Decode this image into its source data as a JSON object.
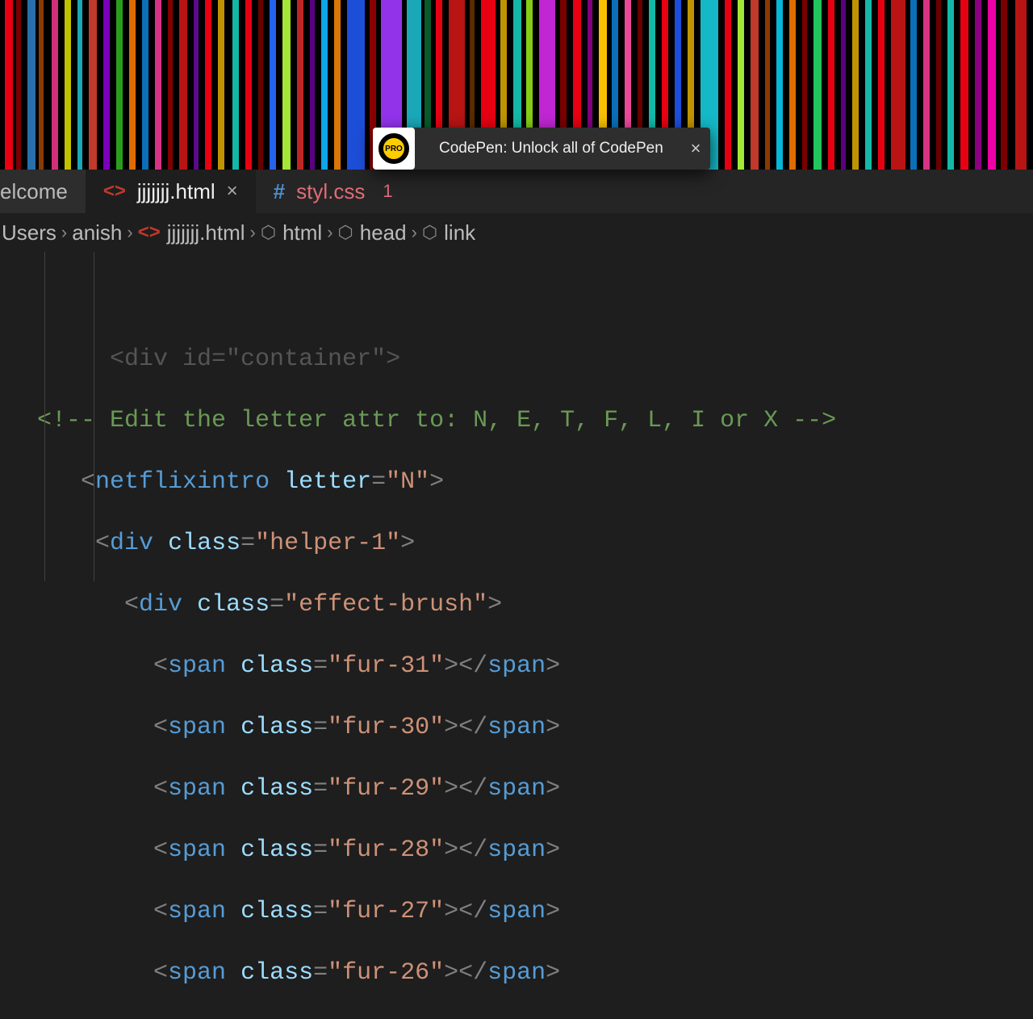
{
  "notification": {
    "badge": "PRO",
    "text": "CodePen: Unlock all of CodePen",
    "close": "×"
  },
  "tabs": {
    "welcome": "elcome",
    "html_file": "jjjjjjj.html",
    "css_file": "styl.css",
    "css_badge": "1",
    "close_x": "×"
  },
  "breadcrumb": {
    "seg0": "Users",
    "seg1": "anish",
    "seg_file": "jjjjjjj.html",
    "seg_html": "html",
    "seg_head": "head",
    "seg_link": "link",
    "sep": "›"
  },
  "code": {
    "partial": "<div id=\"container\">",
    "c1_a": "<!-- ",
    "c1_b": "Edit the letter attr to: N, E, T, F, L, I or X -->",
    "l2_tag": "netflixintro",
    "l2_attr": "letter",
    "l2_val": "\"N\"",
    "l3_tag": "div",
    "l3_attr": "class",
    "l3_val": "\"helper-1\"",
    "l4_tag": "div",
    "l4_attr": "class",
    "l4_val": "\"effect-brush\"",
    "span_tag": "span",
    "span_attr": "class",
    "furs": [
      "\"fur-31\"",
      "\"fur-30\"",
      "\"fur-29\"",
      "\"fur-28\"",
      "\"fur-27\"",
      "\"fur-26\""
    ]
  }
}
